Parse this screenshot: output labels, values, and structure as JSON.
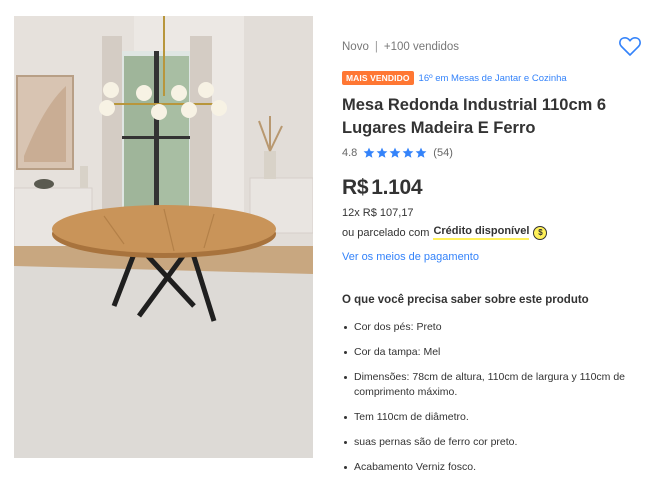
{
  "product_image": {
    "alt_icon": "product-photo"
  },
  "meta": {
    "condition": "Novo",
    "separator": "|",
    "sold": "+100 vendidos"
  },
  "favorite": {
    "icon": "heart-icon"
  },
  "badge": {
    "label": "MAIS VENDIDO",
    "color": "#ff7733"
  },
  "ranking": {
    "text": "16º em Mesas de Jantar e Cozinha"
  },
  "title": "Mesa Redonda Industrial 110cm 6 Lugares Madeira E Ferro",
  "rating": {
    "score": "4.8",
    "stars": 5,
    "count": "(54)",
    "star_color": "#3483fa"
  },
  "price": {
    "currency": "R$",
    "value": "1.104"
  },
  "installments": "12x R$ 107,17",
  "credit": {
    "prefix": "ou parcelado com",
    "link": "Crédito disponível",
    "icon": "mercado-credito-icon"
  },
  "payment_link": "Ver os meios de pagamento",
  "features_title": "O que você precisa saber sobre este produto",
  "features": [
    "Cor dos pés: Preto",
    "Cor da tampa: Mel",
    "Dimensões: 78cm de altura, 110cm de largura y 110cm de comprimento máximo.",
    "Tem 110cm de diâmetro.",
    "suas pernas são de ferro cor preto.",
    "Acabamento Verniz fosco."
  ],
  "colors": {
    "link": "#3483fa",
    "badge": "#ff7733",
    "credit_underline": "#fff159",
    "text": "#333333"
  }
}
